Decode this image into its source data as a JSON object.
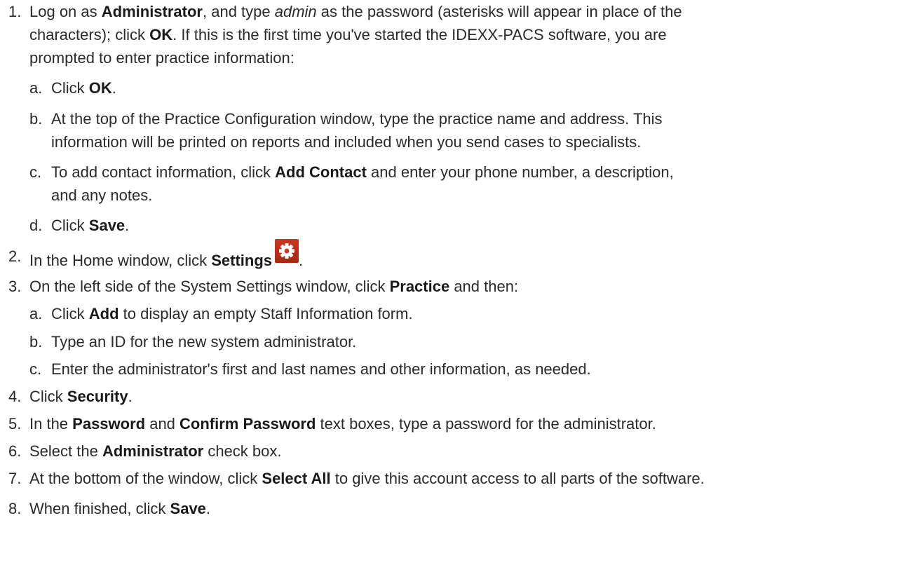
{
  "steps": [
    {
      "number": "1.",
      "lines": [
        [
          {
            "t": "Log on as ",
            "s": "n"
          },
          {
            "t": "Administrator",
            "s": "b"
          },
          {
            "t": ", and type ",
            "s": "n"
          },
          {
            "t": "admin",
            "s": "i"
          },
          {
            "t": " as the password (asterisks will appear in place of the",
            "s": "n"
          }
        ],
        [
          {
            "t": "characters); click ",
            "s": "n"
          },
          {
            "t": "OK",
            "s": "b"
          },
          {
            "t": ". If this is the first time you've started the IDEXX-PACS software, you are",
            "s": "n"
          }
        ],
        [
          {
            "t": "prompted to enter practice information:",
            "s": "n"
          }
        ]
      ],
      "substeps": [
        {
          "letter": "a.",
          "lines": [
            [
              {
                "t": "Click ",
                "s": "n"
              },
              {
                "t": "OK",
                "s": "b"
              },
              {
                "t": ".",
                "s": "n"
              }
            ]
          ]
        },
        {
          "letter": "b.",
          "lines": [
            [
              {
                "t": "At the top of the Practice Configuration window, type the practice name and address. This",
                "s": "n"
              }
            ],
            [
              {
                "t": "information will be printed on reports and included when you send cases to specialists.",
                "s": "n"
              }
            ]
          ]
        },
        {
          "letter": "c.",
          "lines": [
            [
              {
                "t": "To add contact information, click ",
                "s": "n"
              },
              {
                "t": "Add Contact",
                "s": "b"
              },
              {
                "t": " and enter your phone number, a description,",
                "s": "n"
              }
            ],
            [
              {
                "t": "and any notes.",
                "s": "n"
              }
            ]
          ]
        },
        {
          "letter": "d.",
          "lines": [
            [
              {
                "t": "Click ",
                "s": "n"
              },
              {
                "t": "Save",
                "s": "b"
              },
              {
                "t": ".",
                "s": "n"
              }
            ]
          ]
        }
      ]
    },
    {
      "number": "2.",
      "lines": [
        [
          {
            "t": "In the Home window, click ",
            "s": "n"
          },
          {
            "t": "Settings",
            "s": "b"
          }
        ]
      ],
      "trailing": ".",
      "icon": "gear-icon",
      "icon_color": "#c9371f"
    },
    {
      "number": "3.",
      "lines": [
        [
          {
            "t": "On the left side of the System Settings window, click ",
            "s": "n"
          },
          {
            "t": "Practice",
            "s": "b"
          },
          {
            "t": " and then:",
            "s": "n"
          }
        ]
      ],
      "substeps": [
        {
          "letter": "a.",
          "lines": [
            [
              {
                "t": "Click ",
                "s": "n"
              },
              {
                "t": "Add",
                "s": "b"
              },
              {
                "t": " to display an empty Staff Information form.",
                "s": "n"
              }
            ]
          ]
        },
        {
          "letter": "b.",
          "lines": [
            [
              {
                "t": "Type an ID for the new system administrator.",
                "s": "n"
              }
            ]
          ]
        },
        {
          "letter": "c.",
          "lines": [
            [
              {
                "t": "Enter the administrator's first and last names and other information, as needed.",
                "s": "n"
              }
            ]
          ]
        }
      ]
    },
    {
      "number": "4.",
      "lines": [
        [
          {
            "t": "Click ",
            "s": "n"
          },
          {
            "t": "Security",
            "s": "b"
          },
          {
            "t": ".",
            "s": "n"
          }
        ]
      ]
    },
    {
      "number": "5.",
      "lines": [
        [
          {
            "t": "In the ",
            "s": "n"
          },
          {
            "t": "Password",
            "s": "b"
          },
          {
            "t": " and ",
            "s": "n"
          },
          {
            "t": "Confirm Password",
            "s": "b"
          },
          {
            "t": " text boxes, type a password for the administrator.",
            "s": "n"
          }
        ]
      ]
    },
    {
      "number": "6.",
      "lines": [
        [
          {
            "t": "Select the ",
            "s": "n"
          },
          {
            "t": "Administrator",
            "s": "b"
          },
          {
            "t": " check box.",
            "s": "n"
          }
        ]
      ]
    },
    {
      "number": "7.",
      "lines": [
        [
          {
            "t": "At the bottom of the window, click ",
            "s": "n"
          },
          {
            "t": "Select All",
            "s": "b"
          },
          {
            "t": " to give this account access to all parts of the software.",
            "s": "n"
          }
        ]
      ]
    },
    {
      "number": "8.",
      "lines": [
        [
          {
            "t": "When finished, click ",
            "s": "n"
          },
          {
            "t": "Save",
            "s": "b"
          },
          {
            "t": ".",
            "s": "n"
          }
        ]
      ]
    }
  ]
}
